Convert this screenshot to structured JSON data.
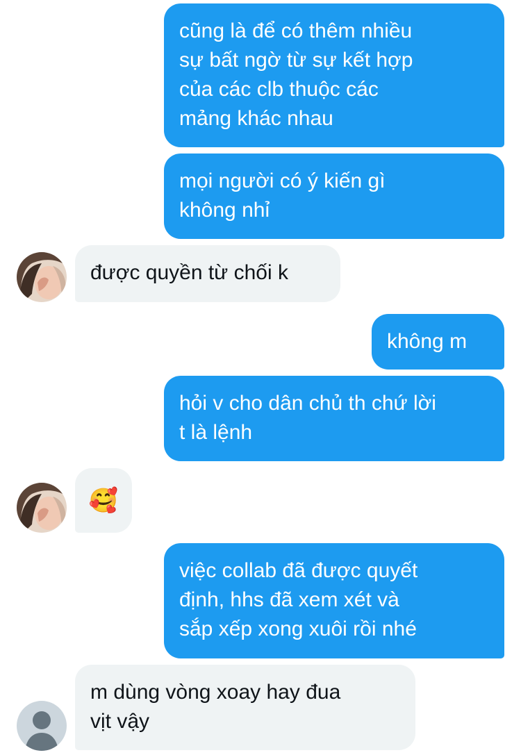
{
  "conversation": {
    "messages": [
      {
        "side": "sent",
        "text": "cũng là để có thêm nhiều\nsự bất ngờ từ sự kết hợp\ncủa các clb thuộc các\nmảng khác nhau"
      },
      {
        "side": "sent",
        "text": "mọi người có ý kiến gì\nkhông nhỉ"
      },
      {
        "side": "received",
        "text": "được quyền từ chối k"
      },
      {
        "side": "sent",
        "text": "không m"
      },
      {
        "side": "sent",
        "text": "hỏi v cho dân chủ th chứ lời\nt là lệnh"
      },
      {
        "side": "received",
        "text": "🥰"
      },
      {
        "side": "sent",
        "text": "việc collab đã được quyết\nđịnh, hhs đã xem xét và\nsắp xếp xong xuôi rồi nhé"
      },
      {
        "side": "received",
        "text": "m dùng vòng xoay hay đua\nvịt vậy"
      }
    ]
  },
  "colors": {
    "sent_bubble": "#1d9bf0",
    "received_bubble": "#eff3f4",
    "sent_text": "#ffffff",
    "received_text": "#0f1419"
  }
}
